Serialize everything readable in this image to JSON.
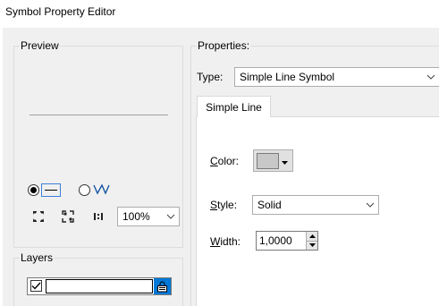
{
  "window": {
    "title": "Symbol Property Editor"
  },
  "preview": {
    "legend": "Preview",
    "radio_line_selected": true,
    "zoom_value": "100%"
  },
  "layers": {
    "legend": "Layers",
    "checked": true
  },
  "properties": {
    "legend": "Properties:",
    "type_label": "Type:",
    "type_value": "Simple Line Symbol",
    "tab_label": "Simple Line",
    "color_label_key": "C",
    "color_label_rest": "olor:",
    "color_value": "#c8c8c8",
    "style_label_key": "S",
    "style_label_rest": "tyle:",
    "style_value": "Solid",
    "width_label_key": "W",
    "width_label_rest": "idth:",
    "width_value": "1,0000"
  },
  "colors": {
    "accent": "#0078d7",
    "panel_bg": "#f0f0f0",
    "group_border": "#dcdcdc"
  }
}
